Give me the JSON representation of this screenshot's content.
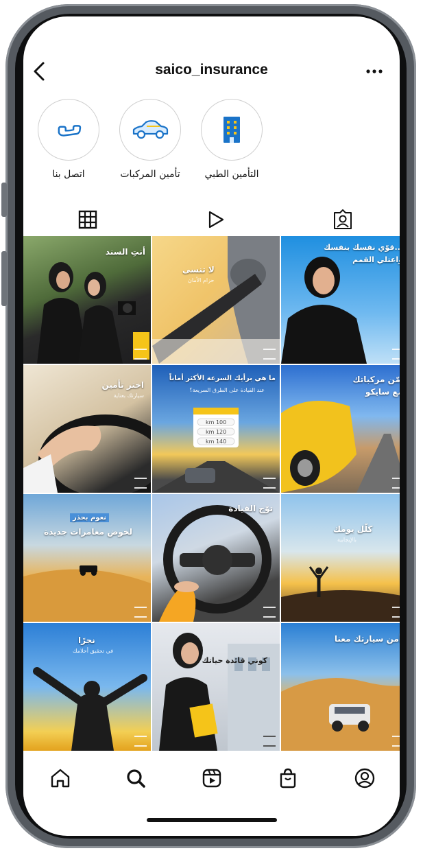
{
  "header": {
    "username": "saico_insurance"
  },
  "highlights": [
    {
      "label": "التأمين الطبي",
      "icon": "building-icon"
    },
    {
      "label": "تأمين المركبات",
      "icon": "car-icon"
    },
    {
      "label": "اتصل بنا",
      "icon": "phone-icon"
    }
  ],
  "tabs": [
    {
      "icon": "grid-icon",
      "active": true
    },
    {
      "icon": "reels-play-icon",
      "active": false
    },
    {
      "icon": "tagged-person-icon",
      "active": false
    }
  ],
  "posts": [
    {
      "caption": "أنتِ السند",
      "sub": ""
    },
    {
      "caption": "لا تنسى",
      "sub": "حزام الأمان"
    },
    {
      "caption": "قوّي نفسك بنفسك...",
      "sub": "واعتلي القمم"
    },
    {
      "caption": "اختر تأمين",
      "sub": "سيارتك بعناية"
    },
    {
      "caption": "ما هي برأيك السرعة الأكثر أماناً",
      "sub": "عند القيادة على الطرق السريعة؟"
    },
    {
      "caption": "أمّن مركباتك",
      "sub": "مع سايكو"
    },
    {
      "caption": "لخوض مغامرات جديدة",
      "sub": "نعوم بحذر"
    },
    {
      "caption": "توّج القيادة",
      "sub": ""
    },
    {
      "caption": "كلّل يومك",
      "sub": "بالإيجابية"
    },
    {
      "caption": "نجرًا",
      "sub": "في تحقيق أحلامك"
    },
    {
      "caption": "كوني قائدة حياتك",
      "sub": ""
    },
    {
      "caption": "أمن سيارتك معنا",
      "sub": ""
    }
  ],
  "poll_options": [
    "km 100",
    "km 120",
    "km 140"
  ],
  "bottom_nav": [
    {
      "icon": "home-icon"
    },
    {
      "icon": "search-icon"
    },
    {
      "icon": "reels-icon"
    },
    {
      "icon": "shop-bag-icon"
    },
    {
      "icon": "profile-icon"
    }
  ],
  "colors": {
    "accent_yellow": "#f5c419",
    "brand_blue": "#1a73c8"
  }
}
